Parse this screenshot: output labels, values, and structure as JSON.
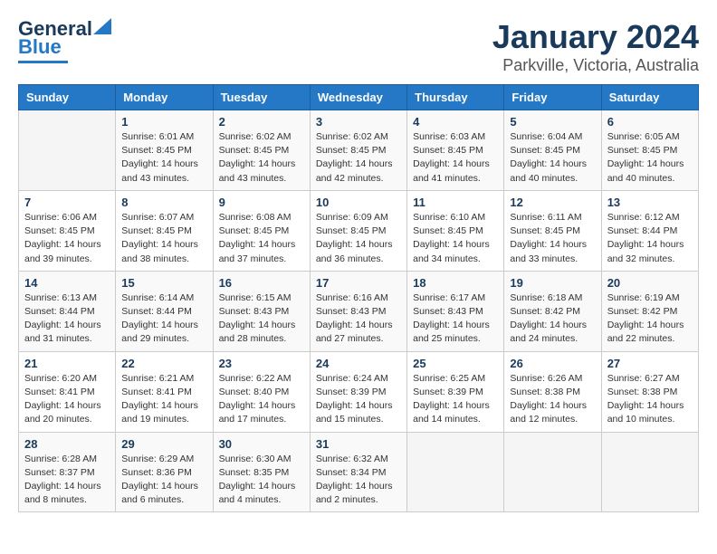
{
  "logo": {
    "line1": "General",
    "line2": "Blue"
  },
  "title": "January 2024",
  "subtitle": "Parkville, Victoria, Australia",
  "days_of_week": [
    "Sunday",
    "Monday",
    "Tuesday",
    "Wednesday",
    "Thursday",
    "Friday",
    "Saturday"
  ],
  "weeks": [
    [
      {
        "day": "",
        "info": ""
      },
      {
        "day": "1",
        "info": "Sunrise: 6:01 AM\nSunset: 8:45 PM\nDaylight: 14 hours\nand 43 minutes."
      },
      {
        "day": "2",
        "info": "Sunrise: 6:02 AM\nSunset: 8:45 PM\nDaylight: 14 hours\nand 43 minutes."
      },
      {
        "day": "3",
        "info": "Sunrise: 6:02 AM\nSunset: 8:45 PM\nDaylight: 14 hours\nand 42 minutes."
      },
      {
        "day": "4",
        "info": "Sunrise: 6:03 AM\nSunset: 8:45 PM\nDaylight: 14 hours\nand 41 minutes."
      },
      {
        "day": "5",
        "info": "Sunrise: 6:04 AM\nSunset: 8:45 PM\nDaylight: 14 hours\nand 40 minutes."
      },
      {
        "day": "6",
        "info": "Sunrise: 6:05 AM\nSunset: 8:45 PM\nDaylight: 14 hours\nand 40 minutes."
      }
    ],
    [
      {
        "day": "7",
        "info": "Sunrise: 6:06 AM\nSunset: 8:45 PM\nDaylight: 14 hours\nand 39 minutes."
      },
      {
        "day": "8",
        "info": "Sunrise: 6:07 AM\nSunset: 8:45 PM\nDaylight: 14 hours\nand 38 minutes."
      },
      {
        "day": "9",
        "info": "Sunrise: 6:08 AM\nSunset: 8:45 PM\nDaylight: 14 hours\nand 37 minutes."
      },
      {
        "day": "10",
        "info": "Sunrise: 6:09 AM\nSunset: 8:45 PM\nDaylight: 14 hours\nand 36 minutes."
      },
      {
        "day": "11",
        "info": "Sunrise: 6:10 AM\nSunset: 8:45 PM\nDaylight: 14 hours\nand 34 minutes."
      },
      {
        "day": "12",
        "info": "Sunrise: 6:11 AM\nSunset: 8:45 PM\nDaylight: 14 hours\nand 33 minutes."
      },
      {
        "day": "13",
        "info": "Sunrise: 6:12 AM\nSunset: 8:44 PM\nDaylight: 14 hours\nand 32 minutes."
      }
    ],
    [
      {
        "day": "14",
        "info": "Sunrise: 6:13 AM\nSunset: 8:44 PM\nDaylight: 14 hours\nand 31 minutes."
      },
      {
        "day": "15",
        "info": "Sunrise: 6:14 AM\nSunset: 8:44 PM\nDaylight: 14 hours\nand 29 minutes."
      },
      {
        "day": "16",
        "info": "Sunrise: 6:15 AM\nSunset: 8:43 PM\nDaylight: 14 hours\nand 28 minutes."
      },
      {
        "day": "17",
        "info": "Sunrise: 6:16 AM\nSunset: 8:43 PM\nDaylight: 14 hours\nand 27 minutes."
      },
      {
        "day": "18",
        "info": "Sunrise: 6:17 AM\nSunset: 8:43 PM\nDaylight: 14 hours\nand 25 minutes."
      },
      {
        "day": "19",
        "info": "Sunrise: 6:18 AM\nSunset: 8:42 PM\nDaylight: 14 hours\nand 24 minutes."
      },
      {
        "day": "20",
        "info": "Sunrise: 6:19 AM\nSunset: 8:42 PM\nDaylight: 14 hours\nand 22 minutes."
      }
    ],
    [
      {
        "day": "21",
        "info": "Sunrise: 6:20 AM\nSunset: 8:41 PM\nDaylight: 14 hours\nand 20 minutes."
      },
      {
        "day": "22",
        "info": "Sunrise: 6:21 AM\nSunset: 8:41 PM\nDaylight: 14 hours\nand 19 minutes."
      },
      {
        "day": "23",
        "info": "Sunrise: 6:22 AM\nSunset: 8:40 PM\nDaylight: 14 hours\nand 17 minutes."
      },
      {
        "day": "24",
        "info": "Sunrise: 6:24 AM\nSunset: 8:39 PM\nDaylight: 14 hours\nand 15 minutes."
      },
      {
        "day": "25",
        "info": "Sunrise: 6:25 AM\nSunset: 8:39 PM\nDaylight: 14 hours\nand 14 minutes."
      },
      {
        "day": "26",
        "info": "Sunrise: 6:26 AM\nSunset: 8:38 PM\nDaylight: 14 hours\nand 12 minutes."
      },
      {
        "day": "27",
        "info": "Sunrise: 6:27 AM\nSunset: 8:38 PM\nDaylight: 14 hours\nand 10 minutes."
      }
    ],
    [
      {
        "day": "28",
        "info": "Sunrise: 6:28 AM\nSunset: 8:37 PM\nDaylight: 14 hours\nand 8 minutes."
      },
      {
        "day": "29",
        "info": "Sunrise: 6:29 AM\nSunset: 8:36 PM\nDaylight: 14 hours\nand 6 minutes."
      },
      {
        "day": "30",
        "info": "Sunrise: 6:30 AM\nSunset: 8:35 PM\nDaylight: 14 hours\nand 4 minutes."
      },
      {
        "day": "31",
        "info": "Sunrise: 6:32 AM\nSunset: 8:34 PM\nDaylight: 14 hours\nand 2 minutes."
      },
      {
        "day": "",
        "info": ""
      },
      {
        "day": "",
        "info": ""
      },
      {
        "day": "",
        "info": ""
      }
    ]
  ]
}
